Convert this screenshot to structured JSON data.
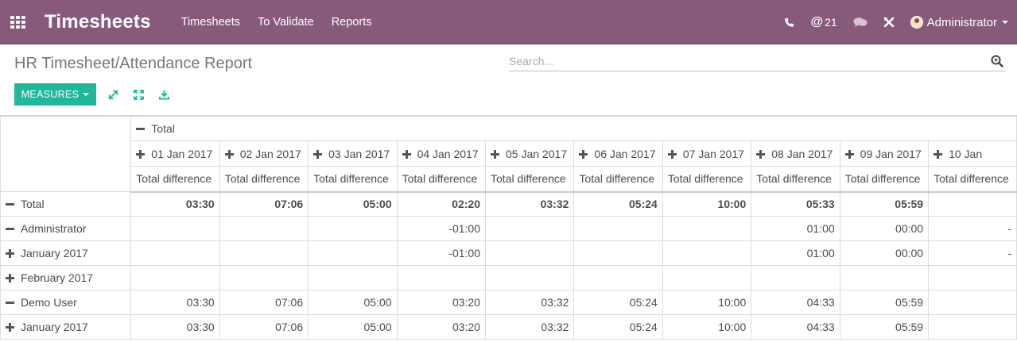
{
  "navbar": {
    "app_title": "Timesheets",
    "menu": [
      "Timesheets",
      "To Validate",
      "Reports"
    ],
    "message_count": "21",
    "user_name": "Administrator",
    "icons": [
      "apps-grid-icon",
      "phone-icon",
      "at-icon",
      "chat-icon",
      "debug-icon"
    ]
  },
  "control_panel": {
    "breadcrumb": "HR Timesheet/Attendance Report",
    "search_placeholder": "Search...",
    "measures_label": "MEASURES",
    "accent_color": "#21b799"
  },
  "pivot": {
    "col_total_label": "Total",
    "columns": [
      "01 Jan 2017",
      "02 Jan 2017",
      "03 Jan 2017",
      "04 Jan 2017",
      "05 Jan 2017",
      "06 Jan 2017",
      "07 Jan 2017",
      "08 Jan 2017",
      "09 Jan 2017",
      "10 Jan"
    ],
    "measure": "Total difference",
    "rows": [
      {
        "label": "Total",
        "values": [
          "03:30",
          "07:06",
          "05:00",
          "02:20",
          "03:32",
          "05:24",
          "10:00",
          "05:33",
          "05:59",
          ""
        ]
      },
      {
        "label": "Administrator",
        "values": [
          "",
          "",
          "",
          "-01:00",
          "",
          "",
          "",
          "01:00",
          "00:00",
          "-"
        ]
      },
      {
        "label": "January 2017",
        "values": [
          "",
          "",
          "",
          "-01:00",
          "",
          "",
          "",
          "01:00",
          "00:00",
          "-"
        ]
      },
      {
        "label": "February 2017",
        "values": [
          "",
          "",
          "",
          "",
          "",
          "",
          "",
          "",
          "",
          ""
        ]
      },
      {
        "label": "Demo User",
        "values": [
          "03:30",
          "07:06",
          "05:00",
          "03:20",
          "03:32",
          "05:24",
          "10:00",
          "04:33",
          "05:59",
          ""
        ]
      },
      {
        "label": "January 2017",
        "values": [
          "03:30",
          "07:06",
          "05:00",
          "03:20",
          "03:32",
          "05:24",
          "10:00",
          "04:33",
          "05:59",
          ""
        ]
      }
    ]
  },
  "colors": {
    "navbar": "#875a7b",
    "primary_button": "#21b799"
  }
}
